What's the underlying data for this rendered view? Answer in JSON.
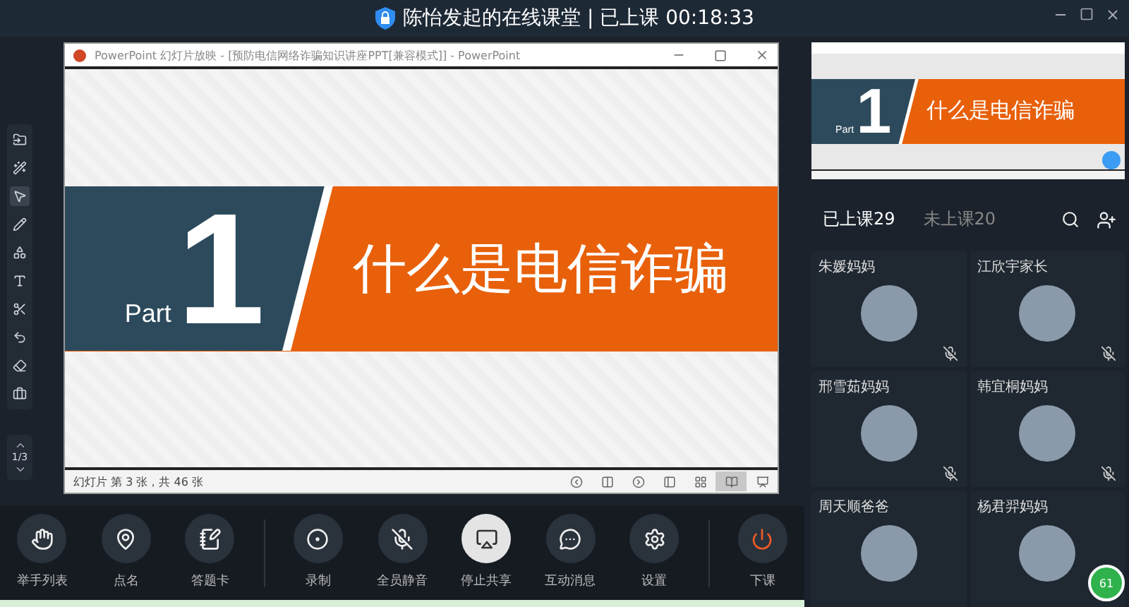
{
  "window": {
    "title": "陈怡发起的在线课堂 | 已上课 00:18:33"
  },
  "ppt_window": {
    "title": "PowerPoint 幻灯片放映 - [预防电信网络诈骗知识讲座PPT[兼容模式]] - PowerPoint",
    "slide": {
      "part_label": "Part",
      "number": "1",
      "heading": "什么是电信诈骗"
    },
    "status_text": "幻灯片 第 3 张，共 46 张",
    "view_buttons": [
      {
        "kind": "prev",
        "selected": false
      },
      {
        "kind": "notes",
        "selected": false
      },
      {
        "kind": "next",
        "selected": false
      },
      {
        "kind": "normal",
        "selected": false
      },
      {
        "kind": "sorter",
        "selected": false
      },
      {
        "kind": "reading",
        "selected": true
      },
      {
        "kind": "show",
        "selected": false
      }
    ]
  },
  "left_tools": [
    {
      "kind": "import",
      "selected": false
    },
    {
      "kind": "laser",
      "selected": false
    },
    {
      "kind": "pointer",
      "selected": true
    },
    {
      "kind": "pen",
      "selected": false
    },
    {
      "kind": "shapes",
      "selected": false
    },
    {
      "kind": "text",
      "selected": false
    },
    {
      "kind": "cut",
      "selected": false
    },
    {
      "kind": "undo",
      "selected": false
    },
    {
      "kind": "eraser",
      "selected": false
    },
    {
      "kind": "toolbox",
      "selected": false
    }
  ],
  "page_indicator": "1/3",
  "preview": {
    "part_label": "Part",
    "number": "1",
    "heading": "什么是电信诈骗"
  },
  "tabs": [
    {
      "label": "已上课29",
      "selected": true
    },
    {
      "label": "未上课20",
      "selected": false
    }
  ],
  "participants": [
    {
      "name": "朱媛妈妈",
      "muted": true
    },
    {
      "name": "江欣宇家长",
      "muted": true
    },
    {
      "name": "邢雪茹妈妈",
      "muted": true
    },
    {
      "name": "韩宜桐妈妈",
      "muted": true
    },
    {
      "name": "周天顺爸爸",
      "muted": false
    },
    {
      "name": "杨君羿妈妈",
      "muted": false
    }
  ],
  "badge": "61",
  "toolbar": [
    {
      "kind": "hand",
      "label": "举手列表",
      "active": false
    },
    {
      "kind": "rollcall",
      "label": "点名",
      "active": false
    },
    {
      "kind": "answer",
      "label": "答题卡",
      "active": false
    },
    {
      "kind": "record",
      "label": "录制",
      "active": false
    },
    {
      "kind": "muteall",
      "label": "全员静音",
      "active": false
    },
    {
      "kind": "share",
      "label": "停止共享",
      "active": true
    },
    {
      "kind": "chat",
      "label": "互动消息",
      "active": false
    },
    {
      "kind": "settings",
      "label": "设置",
      "active": false
    },
    {
      "kind": "power",
      "label": "下课",
      "active": false
    }
  ]
}
